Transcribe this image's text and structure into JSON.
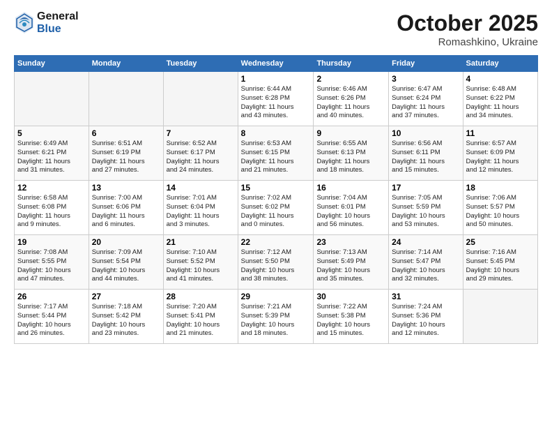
{
  "header": {
    "logo_line1": "General",
    "logo_line2": "Blue",
    "month": "October 2025",
    "location": "Romashkino, Ukraine"
  },
  "weekdays": [
    "Sunday",
    "Monday",
    "Tuesday",
    "Wednesday",
    "Thursday",
    "Friday",
    "Saturday"
  ],
  "weeks": [
    [
      {
        "day": "",
        "info": ""
      },
      {
        "day": "",
        "info": ""
      },
      {
        "day": "",
        "info": ""
      },
      {
        "day": "1",
        "info": "Sunrise: 6:44 AM\nSunset: 6:28 PM\nDaylight: 11 hours\nand 43 minutes."
      },
      {
        "day": "2",
        "info": "Sunrise: 6:46 AM\nSunset: 6:26 PM\nDaylight: 11 hours\nand 40 minutes."
      },
      {
        "day": "3",
        "info": "Sunrise: 6:47 AM\nSunset: 6:24 PM\nDaylight: 11 hours\nand 37 minutes."
      },
      {
        "day": "4",
        "info": "Sunrise: 6:48 AM\nSunset: 6:22 PM\nDaylight: 11 hours\nand 34 minutes."
      }
    ],
    [
      {
        "day": "5",
        "info": "Sunrise: 6:49 AM\nSunset: 6:21 PM\nDaylight: 11 hours\nand 31 minutes."
      },
      {
        "day": "6",
        "info": "Sunrise: 6:51 AM\nSunset: 6:19 PM\nDaylight: 11 hours\nand 27 minutes."
      },
      {
        "day": "7",
        "info": "Sunrise: 6:52 AM\nSunset: 6:17 PM\nDaylight: 11 hours\nand 24 minutes."
      },
      {
        "day": "8",
        "info": "Sunrise: 6:53 AM\nSunset: 6:15 PM\nDaylight: 11 hours\nand 21 minutes."
      },
      {
        "day": "9",
        "info": "Sunrise: 6:55 AM\nSunset: 6:13 PM\nDaylight: 11 hours\nand 18 minutes."
      },
      {
        "day": "10",
        "info": "Sunrise: 6:56 AM\nSunset: 6:11 PM\nDaylight: 11 hours\nand 15 minutes."
      },
      {
        "day": "11",
        "info": "Sunrise: 6:57 AM\nSunset: 6:09 PM\nDaylight: 11 hours\nand 12 minutes."
      }
    ],
    [
      {
        "day": "12",
        "info": "Sunrise: 6:58 AM\nSunset: 6:08 PM\nDaylight: 11 hours\nand 9 minutes."
      },
      {
        "day": "13",
        "info": "Sunrise: 7:00 AM\nSunset: 6:06 PM\nDaylight: 11 hours\nand 6 minutes."
      },
      {
        "day": "14",
        "info": "Sunrise: 7:01 AM\nSunset: 6:04 PM\nDaylight: 11 hours\nand 3 minutes."
      },
      {
        "day": "15",
        "info": "Sunrise: 7:02 AM\nSunset: 6:02 PM\nDaylight: 11 hours\nand 0 minutes."
      },
      {
        "day": "16",
        "info": "Sunrise: 7:04 AM\nSunset: 6:01 PM\nDaylight: 10 hours\nand 56 minutes."
      },
      {
        "day": "17",
        "info": "Sunrise: 7:05 AM\nSunset: 5:59 PM\nDaylight: 10 hours\nand 53 minutes."
      },
      {
        "day": "18",
        "info": "Sunrise: 7:06 AM\nSunset: 5:57 PM\nDaylight: 10 hours\nand 50 minutes."
      }
    ],
    [
      {
        "day": "19",
        "info": "Sunrise: 7:08 AM\nSunset: 5:55 PM\nDaylight: 10 hours\nand 47 minutes."
      },
      {
        "day": "20",
        "info": "Sunrise: 7:09 AM\nSunset: 5:54 PM\nDaylight: 10 hours\nand 44 minutes."
      },
      {
        "day": "21",
        "info": "Sunrise: 7:10 AM\nSunset: 5:52 PM\nDaylight: 10 hours\nand 41 minutes."
      },
      {
        "day": "22",
        "info": "Sunrise: 7:12 AM\nSunset: 5:50 PM\nDaylight: 10 hours\nand 38 minutes."
      },
      {
        "day": "23",
        "info": "Sunrise: 7:13 AM\nSunset: 5:49 PM\nDaylight: 10 hours\nand 35 minutes."
      },
      {
        "day": "24",
        "info": "Sunrise: 7:14 AM\nSunset: 5:47 PM\nDaylight: 10 hours\nand 32 minutes."
      },
      {
        "day": "25",
        "info": "Sunrise: 7:16 AM\nSunset: 5:45 PM\nDaylight: 10 hours\nand 29 minutes."
      }
    ],
    [
      {
        "day": "26",
        "info": "Sunrise: 7:17 AM\nSunset: 5:44 PM\nDaylight: 10 hours\nand 26 minutes."
      },
      {
        "day": "27",
        "info": "Sunrise: 7:18 AM\nSunset: 5:42 PM\nDaylight: 10 hours\nand 23 minutes."
      },
      {
        "day": "28",
        "info": "Sunrise: 7:20 AM\nSunset: 5:41 PM\nDaylight: 10 hours\nand 21 minutes."
      },
      {
        "day": "29",
        "info": "Sunrise: 7:21 AM\nSunset: 5:39 PM\nDaylight: 10 hours\nand 18 minutes."
      },
      {
        "day": "30",
        "info": "Sunrise: 7:22 AM\nSunset: 5:38 PM\nDaylight: 10 hours\nand 15 minutes."
      },
      {
        "day": "31",
        "info": "Sunrise: 7:24 AM\nSunset: 5:36 PM\nDaylight: 10 hours\nand 12 minutes."
      },
      {
        "day": "",
        "info": ""
      }
    ]
  ]
}
